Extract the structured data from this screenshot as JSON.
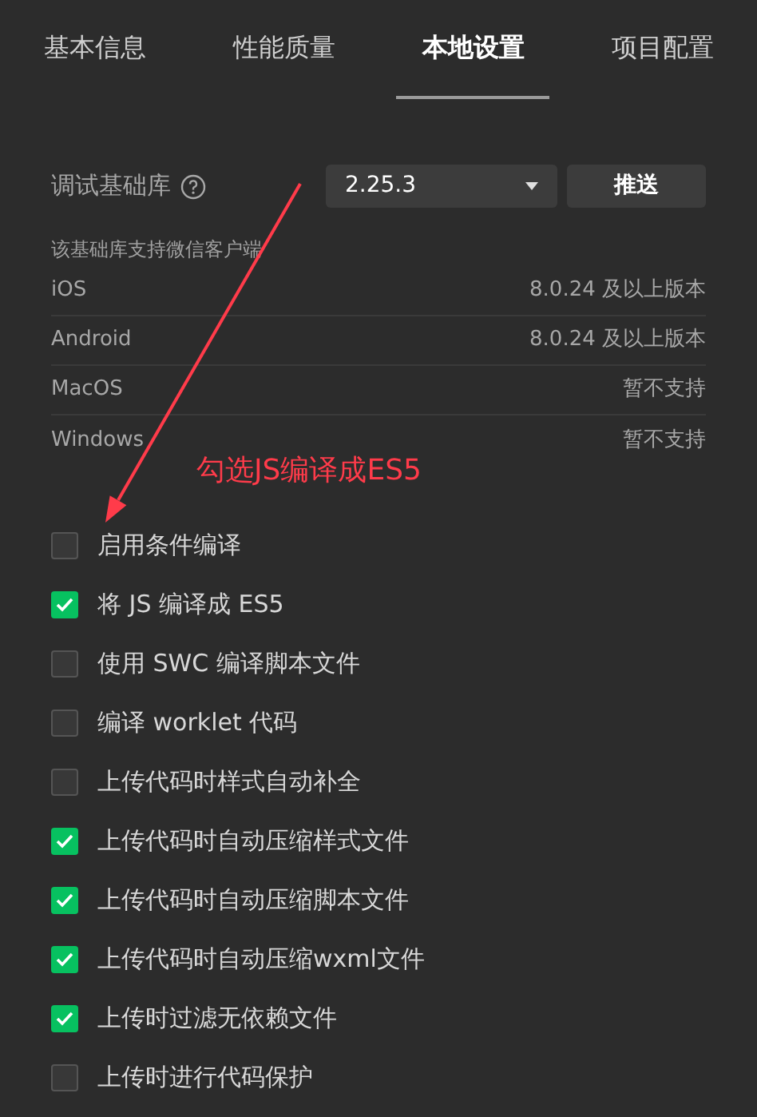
{
  "tabs": [
    {
      "label": "基本信息",
      "selected": false
    },
    {
      "label": "性能质量",
      "selected": false
    },
    {
      "label": "本地设置",
      "selected": true
    },
    {
      "label": "项目配置",
      "selected": false
    }
  ],
  "library": {
    "label": "调试基础库",
    "version": "2.25.3",
    "push_button": "推送"
  },
  "support": {
    "title": "该基础库支持微信客户端",
    "rows": [
      {
        "platform": "iOS",
        "value": "8.0.24 及以上版本"
      },
      {
        "platform": "Android",
        "value": "8.0.24 及以上版本"
      },
      {
        "platform": "MacOS",
        "value": "暂不支持"
      },
      {
        "platform": "Windows",
        "value": "暂不支持"
      }
    ]
  },
  "annotation": {
    "text": "勾选JS编译成ES5"
  },
  "options": [
    {
      "label": "启用条件编译",
      "checked": false
    },
    {
      "label": "将 JS 编译成 ES5",
      "checked": true
    },
    {
      "label": "使用 SWC 编译脚本文件",
      "checked": false
    },
    {
      "label": "编译 worklet 代码",
      "checked": false
    },
    {
      "label": "上传代码时样式自动补全",
      "checked": false
    },
    {
      "label": "上传代码时自动压缩样式文件",
      "checked": true
    },
    {
      "label": "上传代码时自动压缩脚本文件",
      "checked": true
    },
    {
      "label": "上传代码时自动压缩wxml文件",
      "checked": true
    },
    {
      "label": "上传时过滤无依赖文件",
      "checked": true
    },
    {
      "label": "上传时进行代码保护",
      "checked": false
    }
  ]
}
